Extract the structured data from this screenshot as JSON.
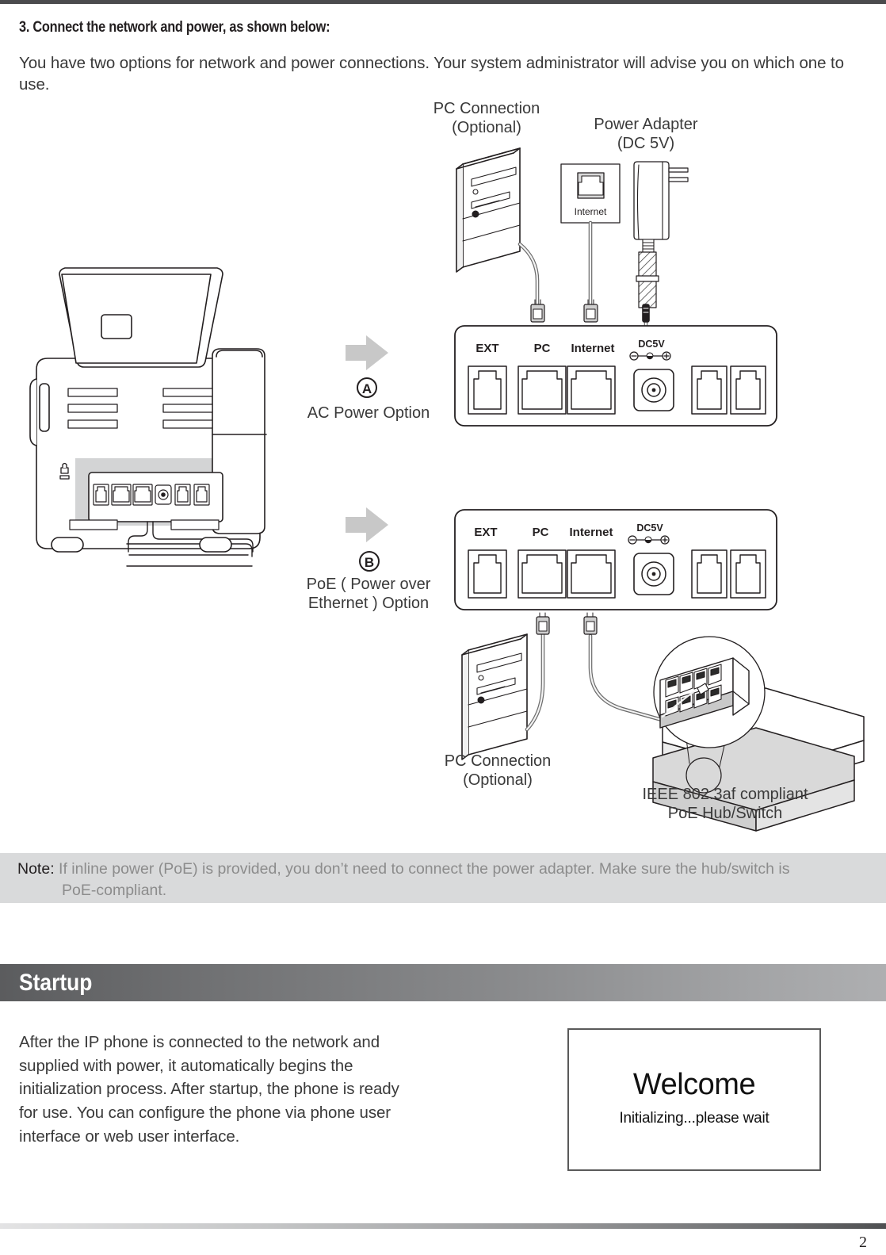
{
  "page": {
    "number": "2"
  },
  "step": {
    "heading": "3. Connect the network and power, as shown below:",
    "intro": "You have two options for network and power connections. Your system administrator will advise you on which one to use."
  },
  "diagram": {
    "labels": {
      "pc_connection_top_line1": "PC Connection",
      "pc_connection_top_line2": "(Optional)",
      "power_adapter_line1": "Power Adapter",
      "power_adapter_line2": "(DC 5V)",
      "option_a_letter": "A",
      "option_a_text": "AC Power Option",
      "option_b_letter": "B",
      "option_b_text_line1": "PoE ( Power over",
      "option_b_text_line2": "Ethernet ) Option",
      "pc_connection_bottom_line1": "PC Connection",
      "pc_connection_bottom_line2": "(Optional)",
      "hub_line1": "IEEE 802.3af compliant",
      "hub_line2": "PoE Hub/Switch",
      "wall_jack": "Internet"
    },
    "port_panel": {
      "ports": [
        "EXT",
        "PC",
        "Internet",
        "DC5V"
      ]
    }
  },
  "note": {
    "label": "Note:",
    "text_line1": "If inline power (PoE) is provided, you don’t need to connect the power adapter. Make sure the hub/switch is",
    "text_line2": "PoE-compliant."
  },
  "startup": {
    "section_title": "Startup",
    "paragraph": "After the IP phone is connected to the network and supplied with power, it automatically begins the initialization process. After startup, the phone is ready for use. You can configure the phone via phone user interface or web user interface.",
    "lcd": {
      "welcome": "Welcome",
      "status": "Initializing...please wait"
    }
  },
  "colors": {
    "rule_dark": "#4b4b4d",
    "note_background": "#d9dadb",
    "arrow_gray": "#c8c8c8",
    "panel_stroke": "#231f20"
  }
}
